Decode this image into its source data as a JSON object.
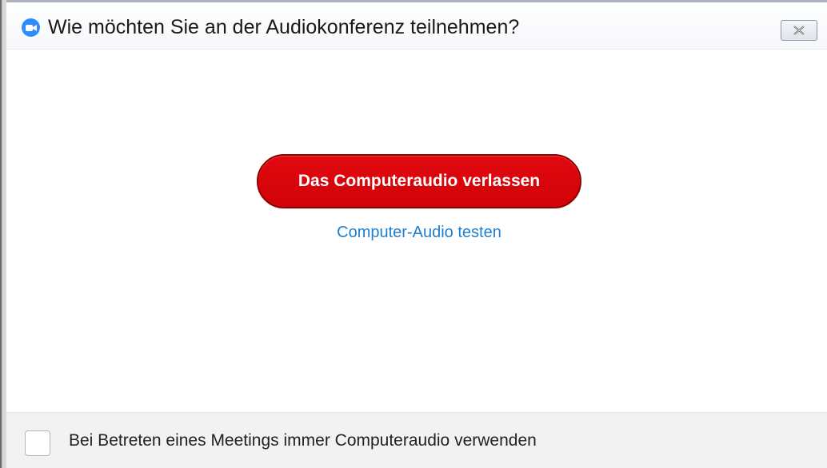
{
  "window": {
    "title": "Wie möchten Sie an der Audiokonferenz teilnehmen?",
    "app_icon": "zoom-camera-icon",
    "close_icon": "close-x-icon"
  },
  "main": {
    "primary_button_label": "Das Computeraudio verlassen",
    "test_link_label": "Computer-Audio testen"
  },
  "footer": {
    "checkbox_checked": false,
    "checkbox_label": "Bei Betreten eines Meetings immer Computeraudio verwenden"
  },
  "colors": {
    "primary_button": "#d10308",
    "link": "#1d7fd1",
    "app_icon": "#2d8cff",
    "footer_bg": "#f2f2f2"
  }
}
